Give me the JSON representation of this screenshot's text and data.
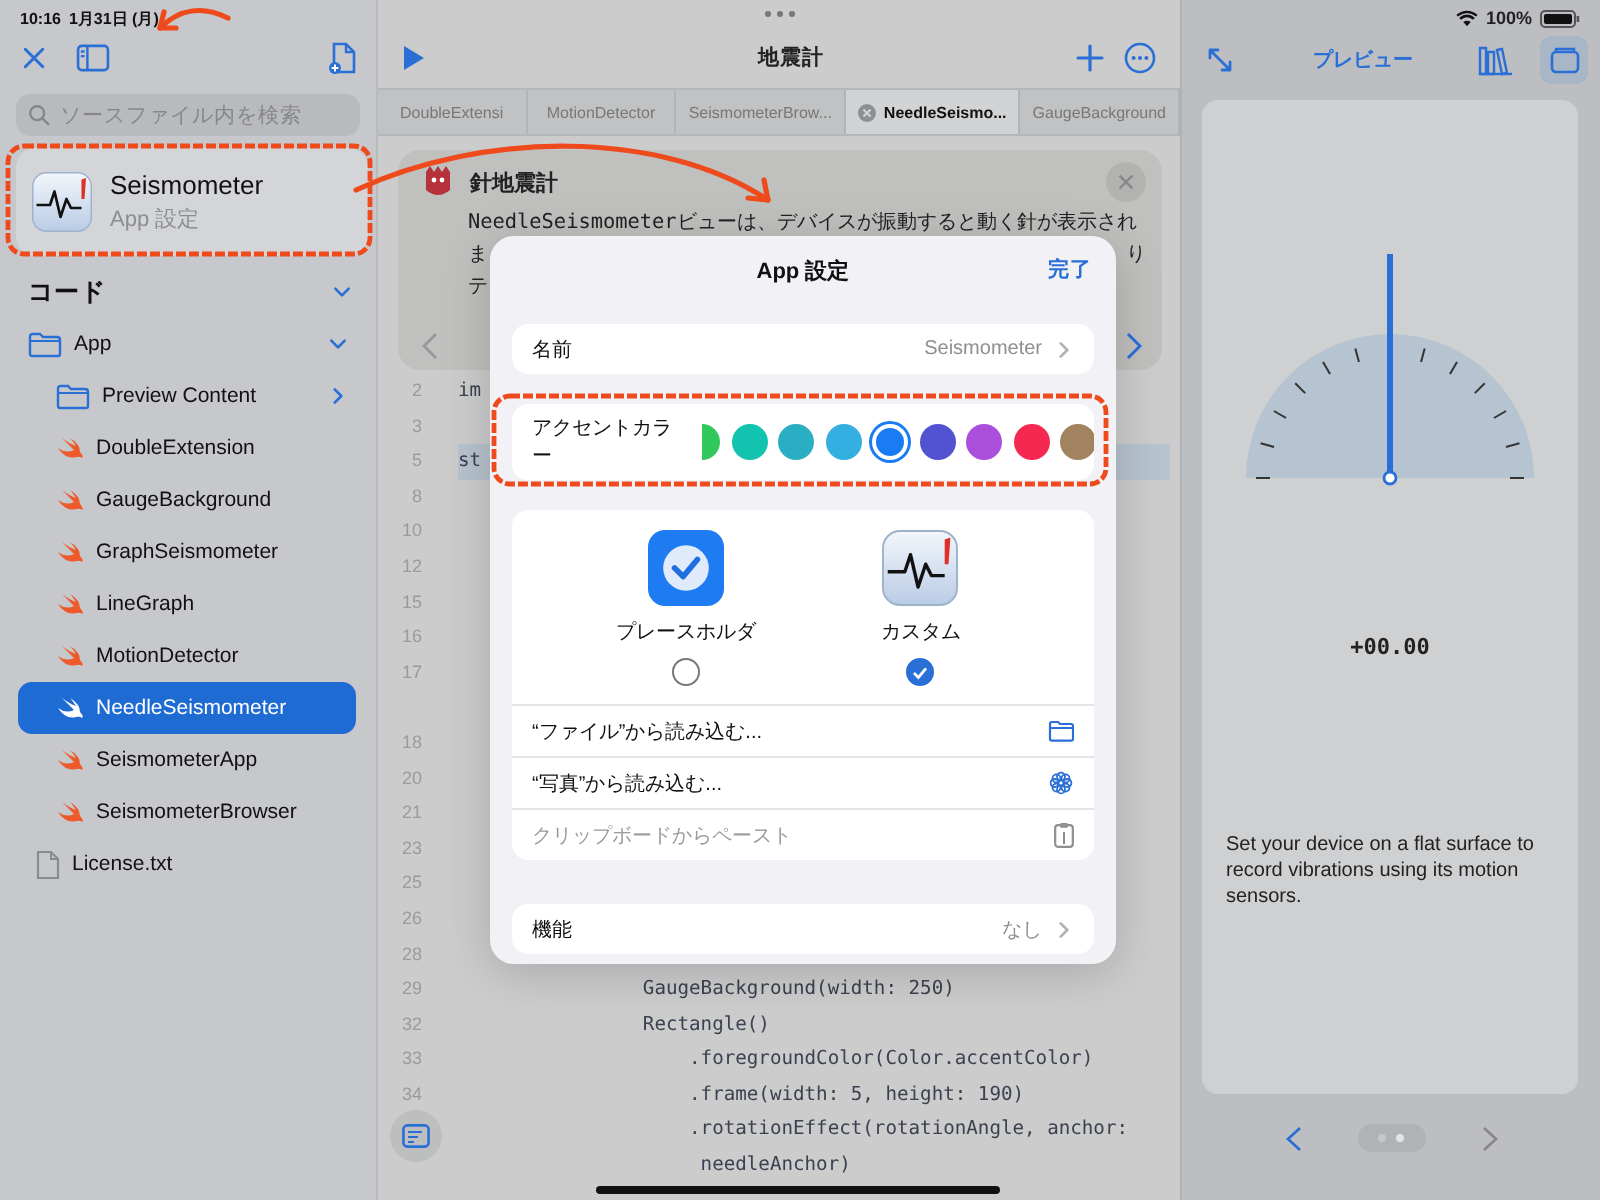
{
  "status_bar": {
    "time": "10:16",
    "date": "1月31日 (月)",
    "battery": "100%"
  },
  "sidebar": {
    "search": {
      "placeholder": "ソースファイル内を検索"
    },
    "app": {
      "name": "Seismometer",
      "subtitle": "App 設定"
    },
    "section": {
      "title": "コード",
      "expanded": true
    },
    "tree": [
      {
        "label": "App",
        "kind": "folder",
        "expanded": true,
        "selected": false,
        "children": [
          {
            "label": "Preview Content",
            "kind": "folder",
            "expanded": false,
            "selected": false
          },
          {
            "label": "DoubleExtension",
            "kind": "swift",
            "selected": false
          },
          {
            "label": "GaugeBackground",
            "kind": "swift",
            "selected": false
          },
          {
            "label": "GraphSeismometer",
            "kind": "swift",
            "selected": false
          },
          {
            "label": "LineGraph",
            "kind": "swift",
            "selected": false
          },
          {
            "label": "MotionDetector",
            "kind": "swift",
            "selected": false
          },
          {
            "label": "NeedleSeismometer",
            "kind": "swift",
            "selected": true
          },
          {
            "label": "SeismometerApp",
            "kind": "swift",
            "selected": false
          },
          {
            "label": "SeismometerBrowser",
            "kind": "swift",
            "selected": false
          }
        ]
      },
      {
        "label": "License.txt",
        "kind": "file",
        "selected": false
      }
    ]
  },
  "editor": {
    "title": "地震計",
    "tabs": [
      {
        "label": "DoubleExtensi",
        "selected": false
      },
      {
        "label": "MotionDetector",
        "selected": false
      },
      {
        "label": "SeismometerBrow...",
        "selected": false
      },
      {
        "label": "NeedleSeismo...",
        "selected": true
      },
      {
        "label": "GaugeBackground",
        "selected": false
      }
    ],
    "guide": {
      "title": "針地震計",
      "lines": [
        [
          "NeedleSeismometerビューは、デバイスが振動すると動く針が表示され"
        ],
        [
          "ま",
          "り"
        ],
        [
          "テ"
        ]
      ]
    },
    "code": [
      {
        "number": "2",
        "code": "im",
        "highlighted": false,
        "wrapped": false
      },
      {
        "number": "3",
        "highlighted": false,
        "wrapped": false
      },
      {
        "number": "5",
        "code": "st",
        "highlighted": true,
        "wrapped": false
      },
      {
        "number": "8",
        "highlighted": false,
        "wrapped": false
      },
      {
        "number": "10",
        "highlighted": false,
        "wrapped": false
      },
      {
        "number": "12",
        "highlighted": false,
        "wrapped": false
      },
      {
        "number": "15",
        "highlighted": false,
        "wrapped": false
      },
      {
        "number": "16",
        "highlighted": false,
        "wrapped": false
      },
      {
        "number": "17",
        "highlighted": false,
        "wrapped": true
      },
      {
        "number": "18",
        "highlighted": false,
        "wrapped": false
      },
      {
        "number": "20",
        "highlighted": false,
        "wrapped": false
      },
      {
        "number": "21",
        "highlighted": false,
        "wrapped": false
      },
      {
        "number": "23",
        "highlighted": false,
        "wrapped": false
      },
      {
        "number": "25",
        "highlighted": false,
        "wrapped": false
      },
      {
        "number": "26",
        "highlighted": false,
        "wrapped": false
      },
      {
        "number": "28",
        "highlighted": false,
        "wrapped": false
      },
      {
        "number": "29",
        "code": "                GaugeBackground(width: 250)",
        "highlighted": false,
        "wrapped": false
      },
      {
        "number": "32",
        "code": "                Rectangle()",
        "highlighted": false,
        "wrapped": false
      },
      {
        "number": "33",
        "code": "                    .foregroundColor(Color.accentColor)",
        "highlighted": false,
        "wrapped": false
      },
      {
        "number": "34",
        "code": "                    .frame(width: 5, height: 190)",
        "highlighted": false,
        "wrapped": false
      },
      {
        "code": "                    .rotationEffect(rotationAngle, anchor:",
        "continuation": "                     needleAnchor)",
        "highlighted": false,
        "wrapped": false
      }
    ]
  },
  "settings": {
    "title": "App 設定",
    "done": "完了",
    "name_row": {
      "label": "名前",
      "value": "Seismometer"
    },
    "accent": {
      "label": "アクセントカラー",
      "colors": [
        {
          "color": "#30c85a",
          "selected": false
        },
        {
          "color": "#12c4b0",
          "selected": false
        },
        {
          "color": "#2aaec4",
          "selected": false
        },
        {
          "color": "#35aee2",
          "selected": false
        },
        {
          "color": "#1a7cf5",
          "selected": true
        },
        {
          "color": "#5253d0",
          "selected": false
        },
        {
          "color": "#aa4fdc",
          "selected": false
        },
        {
          "color": "#f5294f",
          "selected": false
        },
        {
          "color": "#a1845f",
          "selected": false
        }
      ]
    },
    "icon_options": [
      {
        "label": "プレースホルダ",
        "kind": "placeholder",
        "selected": false
      },
      {
        "label": "カスタム",
        "kind": "custom",
        "selected": true
      }
    ],
    "actions": [
      {
        "label": "“ファイル”から読み込む...",
        "kind": "folder",
        "disabled": false
      },
      {
        "label": "“写真”から読み込む...",
        "kind": "photos",
        "disabled": false
      },
      {
        "label": "クリップボードからペースト",
        "kind": "clipboard",
        "disabled": true
      }
    ],
    "feature_row": {
      "label": "機能",
      "value": "なし"
    }
  },
  "preview": {
    "title": "プレビュー",
    "buttons": [
      {
        "kind": "library",
        "selected": false
      },
      {
        "kind": "device",
        "selected": true
      }
    ],
    "reading": "+00.00",
    "message": "Set your device on a flat surface to record vibrations using its motion sensors.",
    "pages": [
      {
        "selected": false
      },
      {
        "selected": true
      }
    ]
  }
}
